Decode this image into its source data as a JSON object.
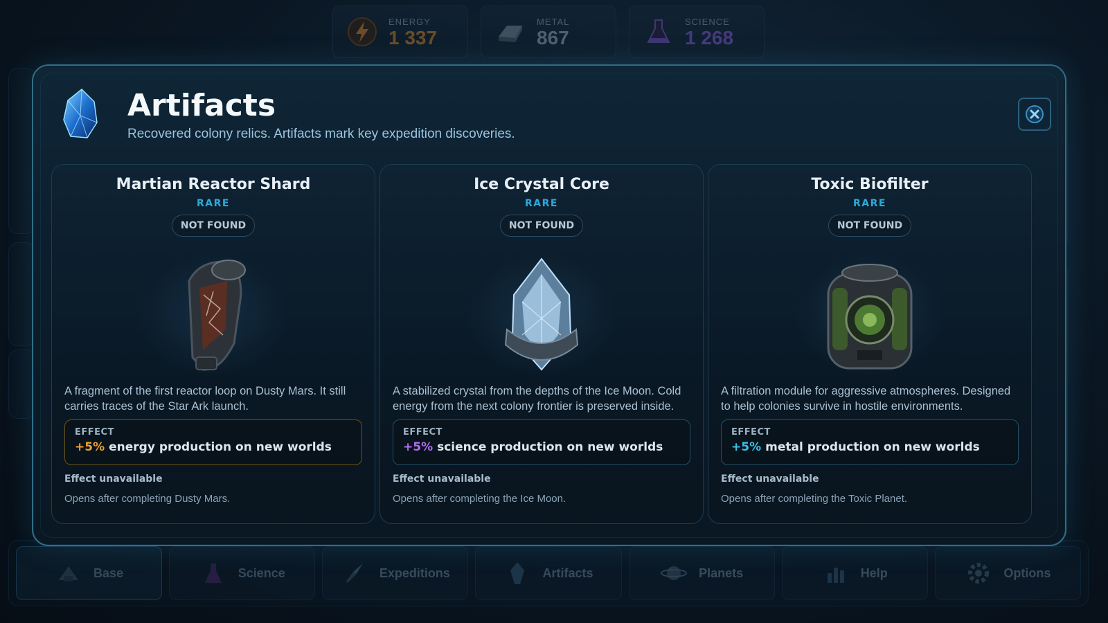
{
  "resources": [
    {
      "label": "ENERGY",
      "value": "1 337",
      "icon": "lightning-icon",
      "color": "#d9892a"
    },
    {
      "label": "METAL",
      "value": "867",
      "icon": "metal-ingot-icon",
      "color": "#9fb0bd"
    },
    {
      "label": "SCIENCE",
      "value": "1 268",
      "icon": "flask-icon",
      "color": "#8a5ad8"
    }
  ],
  "modal": {
    "title": "Artifacts",
    "subtitle": "Recovered colony relics. Artifacts mark key expedition discoveries.",
    "close_icon": "close-icon"
  },
  "cards": [
    {
      "name": "Martian Reactor Shard",
      "rarity": "RARE",
      "status": "NOT FOUND",
      "art": "reactor-shard-art",
      "description": "A fragment of the first reactor loop on Dusty Mars. It still carries traces of the Star Ark launch.",
      "effect_label": "EFFECT",
      "effect_pct": "+5%",
      "effect_text": "energy production on new worlds",
      "effect_color": "#f0a030",
      "unavailable_title": "Effect unavailable",
      "unavailable_note": "Opens after completing Dusty Mars."
    },
    {
      "name": "Ice Crystal Core",
      "rarity": "RARE",
      "status": "NOT FOUND",
      "art": "ice-crystal-art",
      "description": "A stabilized crystal from the depths of the Ice Moon. Cold energy from the next colony frontier is preserved inside.",
      "effect_label": "EFFECT",
      "effect_pct": "+5%",
      "effect_text": "science production on new worlds",
      "effect_color": "#b46cf0",
      "unavailable_title": "Effect unavailable",
      "unavailable_note": "Opens after completing the Ice Moon."
    },
    {
      "name": "Toxic Biofilter",
      "rarity": "RARE",
      "status": "NOT FOUND",
      "art": "biofilter-art",
      "description": "A filtration module for aggressive atmospheres. Designed to help colonies survive in hostile environments.",
      "effect_label": "EFFECT",
      "effect_pct": "+5%",
      "effect_text": "metal production on new worlds",
      "effect_color": "#3cc0e8",
      "unavailable_title": "Effect unavailable",
      "unavailable_note": "Opens after completing the Toxic Planet."
    }
  ],
  "bottom_nav": [
    {
      "label": "Base",
      "icon": "base-icon"
    },
    {
      "label": "Science",
      "icon": "flask-icon"
    },
    {
      "label": "Expeditions",
      "icon": "rocket-icon"
    },
    {
      "label": "Artifacts",
      "icon": "crystal-icon"
    },
    {
      "label": "Planets",
      "icon": "planet-icon"
    },
    {
      "label": "Help",
      "icon": "help-icon"
    },
    {
      "label": "Options",
      "icon": "gear-icon"
    }
  ]
}
